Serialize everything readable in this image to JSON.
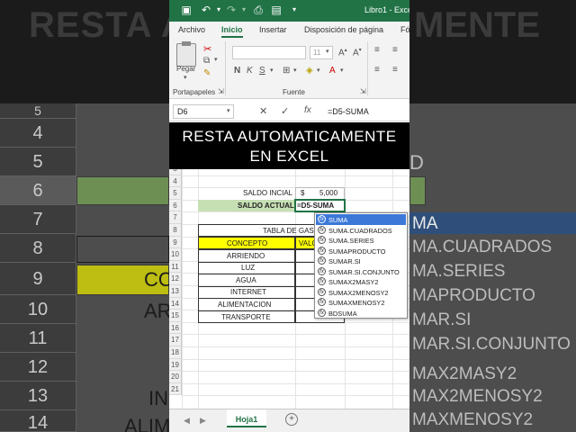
{
  "background": {
    "title_left": "RESTA A",
    "title_right": "MENTE",
    "row_numbers": [
      "5",
      "4",
      "5",
      "6",
      "7",
      "8",
      "9",
      "10",
      "11",
      "12",
      "13",
      "14"
    ],
    "left_cells": {
      "row9": "CO",
      "row10": "AR",
      "row13": "IN",
      "row14": "ALIM"
    },
    "right_list": [
      "MA",
      "MA.CUADRADOS",
      "MA.SERIES",
      "MAPRODUCTO",
      "MAR.SI",
      "MAR.SI.CONJUNTO",
      "MAX2MASY2",
      "MAX2MENOSY2",
      "MAXMENOSY2"
    ],
    "right_cell_d": "D"
  },
  "titlebar": {
    "title": "Libro1 - Exce"
  },
  "menu": [
    "Archivo",
    "Inicio",
    "Insertar",
    "Disposición de página",
    "Fó"
  ],
  "ribbon": {
    "paste_label": "Pegar",
    "clipboard_label": "Portapapeles",
    "font_label": "Fuente",
    "font_size": "11"
  },
  "formula_bar": {
    "name_box": "D6",
    "cancel_icon": "✕",
    "enter_icon": "✓",
    "fx_label": "fx",
    "formula": "=D5-SUMA"
  },
  "caption": {
    "line1": "RESTA AUTOMATICAMENTE",
    "line2": "EN EXCEL"
  },
  "sheet": {
    "row_numbers": [
      "3",
      "4",
      "5",
      "6",
      "7",
      "8",
      "9",
      "10",
      "11",
      "12",
      "13",
      "14",
      "15",
      "16",
      "17",
      "18",
      "19",
      "20",
      "21"
    ],
    "saldo_inicial_label": "SALDO INCIAL",
    "saldo_inicial_currency": "$",
    "saldo_inicial_value": "5,000",
    "saldo_actual_label": "SALDO ACTUAL",
    "saldo_actual_formula": "=D5-SUMA",
    "tabla_title": "TABLA DE GAS",
    "concepto_header": "CONCEPTO",
    "valor_header": "VALC",
    "conceptos": [
      "ARRIENDO",
      "LUZ",
      "AGUA",
      "INTERNET",
      "ALIMENTACION",
      "TRANSPORTE"
    ]
  },
  "autocomplete": {
    "items": [
      "SUMA",
      "SUMA.CUADRADOS",
      "SUMA.SERIES",
      "SUMAPRODUCTO",
      "SUMAR.SI",
      "SUMAR.SI.CONJUNTO",
      "SUMAX2MASY2",
      "SUMAX2MENOSY2",
      "SUMAXMENOSY2",
      "BDSUMA"
    ],
    "selected_index": 0,
    "icon_glyph": "fx"
  },
  "sheet_tabs": {
    "active": "Hoja1",
    "add": "+"
  }
}
